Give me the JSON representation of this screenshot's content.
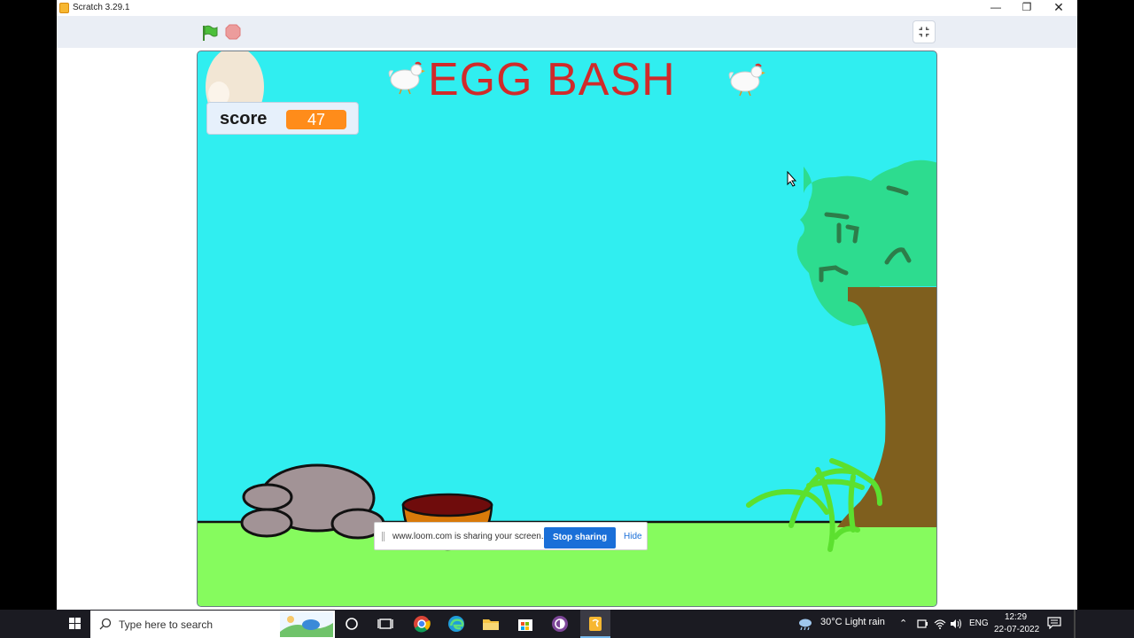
{
  "window": {
    "title": "Scratch 3.29.1",
    "minimize_glyph": "—",
    "maximize_glyph": "❐",
    "close_glyph": "✕"
  },
  "toolbar": {
    "green_flag": "green-flag-icon",
    "stop": "stop-icon",
    "fullscreen": "exit-fullscreen-icon"
  },
  "stage": {
    "game_title": "EGG BASH",
    "score_monitor": {
      "label": "score",
      "value": "47"
    },
    "colors": {
      "sky": "#30eef0",
      "ground": "#86fb5e",
      "title": "#d02a2a",
      "score_value_bg": "#ff8c1a",
      "tree_leaves": "#2ddc8f",
      "tree_trunk": "#7f5f1e",
      "basket": "#d97a0a",
      "rock": "#a29396"
    },
    "sprites": [
      "egg",
      "hen-left",
      "hen-right",
      "tree",
      "rocks",
      "basket",
      "grass-bush"
    ]
  },
  "loom": {
    "message": "www.loom.com is sharing your screen.",
    "stop_label": "Stop sharing",
    "hide_label": "Hide"
  },
  "taskbar": {
    "search_placeholder": "Type here to search",
    "weather": "30°C  Light rain",
    "language": "ENG",
    "time": "12:29",
    "date": "22-07-2022",
    "pinned": [
      "cortana-icon",
      "task-view-icon",
      "chrome-icon",
      "edge-icon",
      "file-explorer-icon",
      "store-icon",
      "tor-icon",
      "scratch-icon"
    ]
  }
}
